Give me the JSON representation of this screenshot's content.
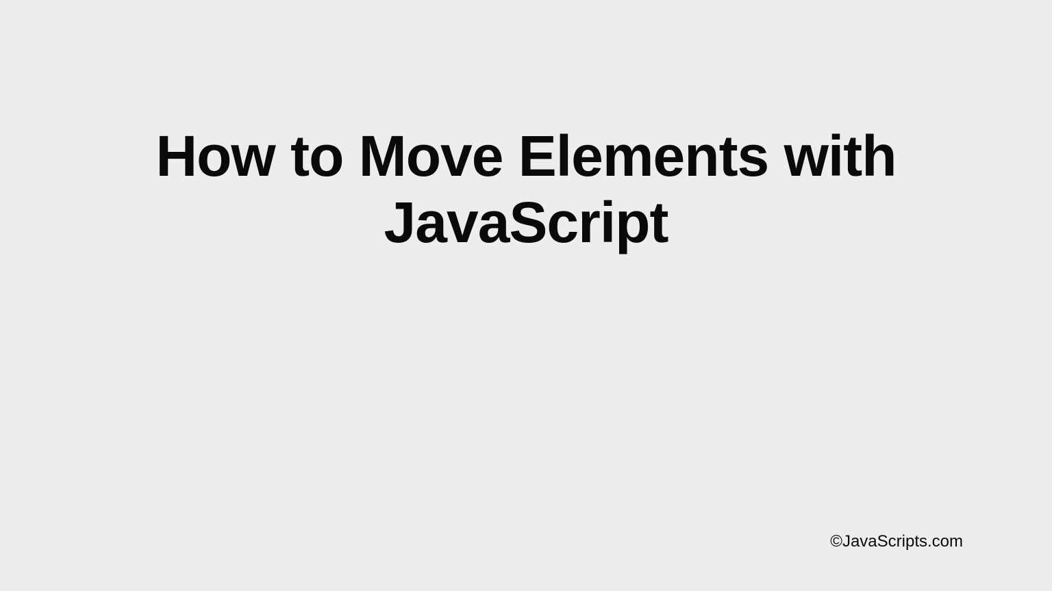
{
  "slide": {
    "title": "How to Move Elements with JavaScript",
    "attribution": "©JavaScripts.com"
  }
}
